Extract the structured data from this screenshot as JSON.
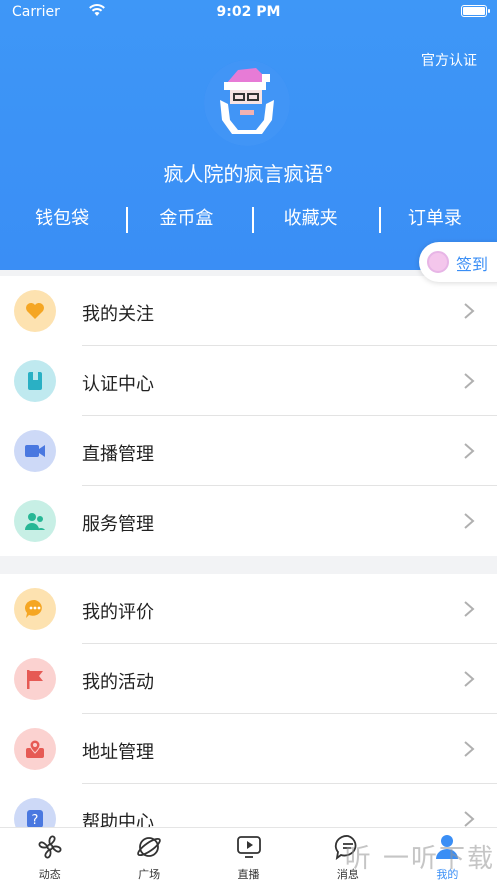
{
  "status_bar": {
    "carrier": "Carrier",
    "time": "9:02 PM"
  },
  "header": {
    "official_label": "官方认证",
    "username": "疯人院的疯言疯语°",
    "quick_links": [
      "钱包袋",
      "金币盒",
      "收藏夹",
      "订单录"
    ],
    "checkin_label": "签到",
    "brand_color": "#3a8ef5"
  },
  "menu_group_1": [
    {
      "label": "我的关注",
      "icon": "heart-icon",
      "color": "#fde2b0"
    },
    {
      "label": "认证中心",
      "icon": "book-icon",
      "color": "#bfe9ef"
    },
    {
      "label": "直播管理",
      "icon": "video-camera-icon",
      "color": "#cdd9f7"
    },
    {
      "label": "服务管理",
      "icon": "people-icon",
      "color": "#c7efe5"
    }
  ],
  "menu_group_2": [
    {
      "label": "我的评价",
      "icon": "comment-icon",
      "color": "#fde2b0"
    },
    {
      "label": "我的活动",
      "icon": "flag-icon",
      "color": "#fbd2d0"
    },
    {
      "label": "地址管理",
      "icon": "location-icon",
      "color": "#fbd2d0"
    },
    {
      "label": "帮助中心",
      "icon": "help-icon",
      "color": "#cdd9f7"
    }
  ],
  "tabbar": [
    {
      "label": "动态",
      "icon": "fan-icon"
    },
    {
      "label": "广场",
      "icon": "planet-icon"
    },
    {
      "label": "直播",
      "icon": "play-icon"
    },
    {
      "label": "消息",
      "icon": "message-icon"
    },
    {
      "label": "我的",
      "icon": "person-icon",
      "active": true
    }
  ],
  "watermark": "听 一听下载"
}
